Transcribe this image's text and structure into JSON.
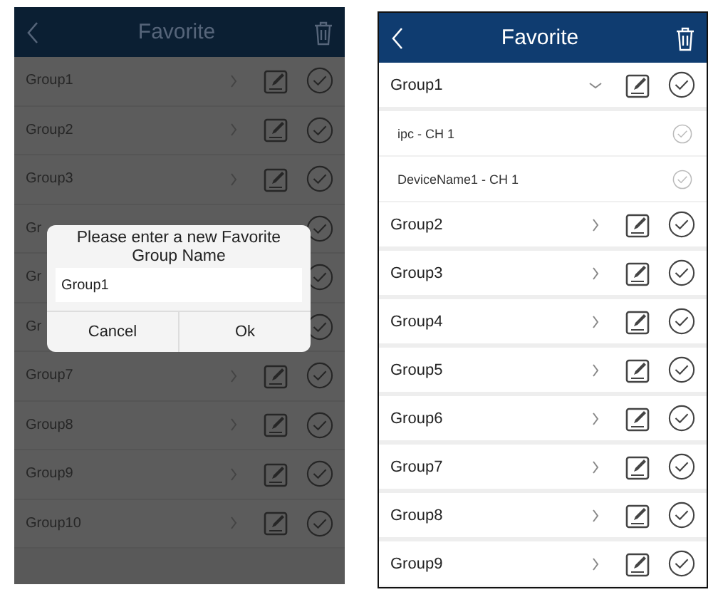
{
  "screens": [
    {
      "title": "Favorite",
      "dimmed": true,
      "groups": [
        {
          "name": "Group1",
          "kind": "full",
          "expanded": false
        },
        {
          "name": "Group2",
          "kind": "full",
          "expanded": false
        },
        {
          "name": "Group3",
          "kind": "full",
          "expanded": false
        },
        {
          "name": "Gr",
          "kind": "covered"
        },
        {
          "name": "Gr",
          "kind": "covered"
        },
        {
          "name": "Gr",
          "kind": "covered"
        },
        {
          "name": "Group7",
          "kind": "full",
          "expanded": false
        },
        {
          "name": "Group8",
          "kind": "full",
          "expanded": false
        },
        {
          "name": "Group9",
          "kind": "full",
          "expanded": false
        },
        {
          "name": "Group10",
          "kind": "full",
          "expanded": false
        }
      ],
      "dialog": {
        "message": "Please enter a new Favorite Group Name",
        "value": "Group1",
        "buttons": [
          "Cancel",
          "Ok"
        ]
      }
    },
    {
      "title": "Favorite",
      "dimmed": false,
      "groups": [
        {
          "name": "Group1",
          "kind": "full",
          "expanded": true,
          "children": [
            {
              "name": "ipc - CH 1"
            },
            {
              "name": "DeviceName1 - CH 1"
            }
          ]
        },
        {
          "name": "Group2",
          "kind": "full",
          "expanded": false
        },
        {
          "name": "Group3",
          "kind": "full",
          "expanded": false
        },
        {
          "name": "Group4",
          "kind": "full",
          "expanded": false
        },
        {
          "name": "Group5",
          "kind": "full",
          "expanded": false
        },
        {
          "name": "Group6",
          "kind": "full",
          "expanded": false
        },
        {
          "name": "Group7",
          "kind": "full",
          "expanded": false
        },
        {
          "name": "Group8",
          "kind": "full",
          "expanded": false
        },
        {
          "name": "Group9",
          "kind": "full",
          "expanded": false
        }
      ]
    }
  ]
}
